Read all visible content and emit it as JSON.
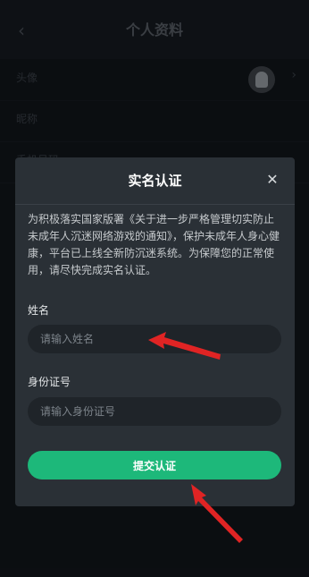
{
  "header": {
    "back_icon": "chevron-left-icon",
    "title": "个人资料"
  },
  "profile": {
    "rows": [
      {
        "label": "头像",
        "value": ""
      },
      {
        "label": "昵称",
        "value": ""
      },
      {
        "label": "手机号码",
        "value": ""
      }
    ]
  },
  "modal": {
    "title": "实名认证",
    "close_icon": "close-icon",
    "notice": "为积极落实国家版署《关于进一步严格管理切实防止未成年人沉迷网络游戏的通知》，保护未成年人身心健康，平台已上线全新防沉迷系统。为保障您的正常使用，请尽快完成实名认证。",
    "name_label": "姓名",
    "name_placeholder": "请输入姓名",
    "name_value": "",
    "id_label": "身份证号",
    "id_placeholder": "请输入身份证号",
    "id_value": "",
    "submit_label": "提交认证"
  },
  "colors": {
    "accent": "#1db87a",
    "annotation_arrow": "#e02424"
  }
}
